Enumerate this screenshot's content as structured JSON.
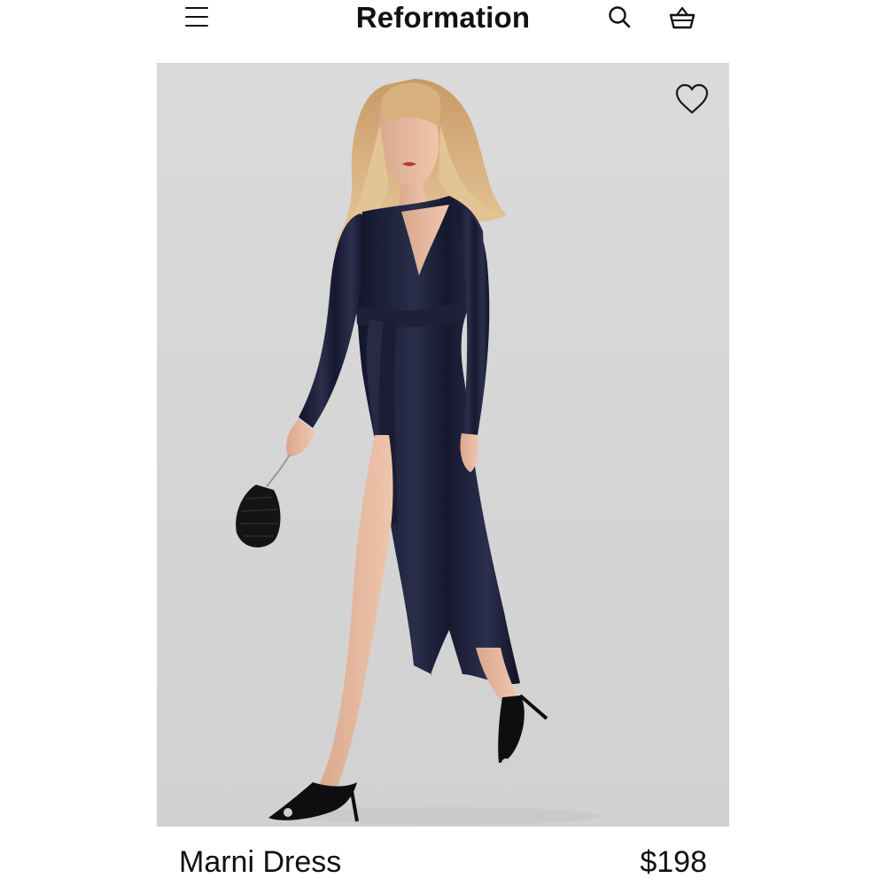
{
  "header": {
    "brand": "Reformation",
    "menu_icon": "hamburger-menu-icon",
    "search_icon": "search-icon",
    "bag_icon": "shopping-basket-icon"
  },
  "product": {
    "name": "Marni Dress",
    "price": "$198",
    "image_alt": "Model wearing a navy satin long-sleeve wrap midi dress with front slit, holding a black beaded mini bag, wearing black pointed heels",
    "wishlist_icon": "heart-outline-icon"
  },
  "colors": {
    "image_background": "#d6d6d6",
    "dress": "#1c1f33",
    "text": "#111111"
  }
}
